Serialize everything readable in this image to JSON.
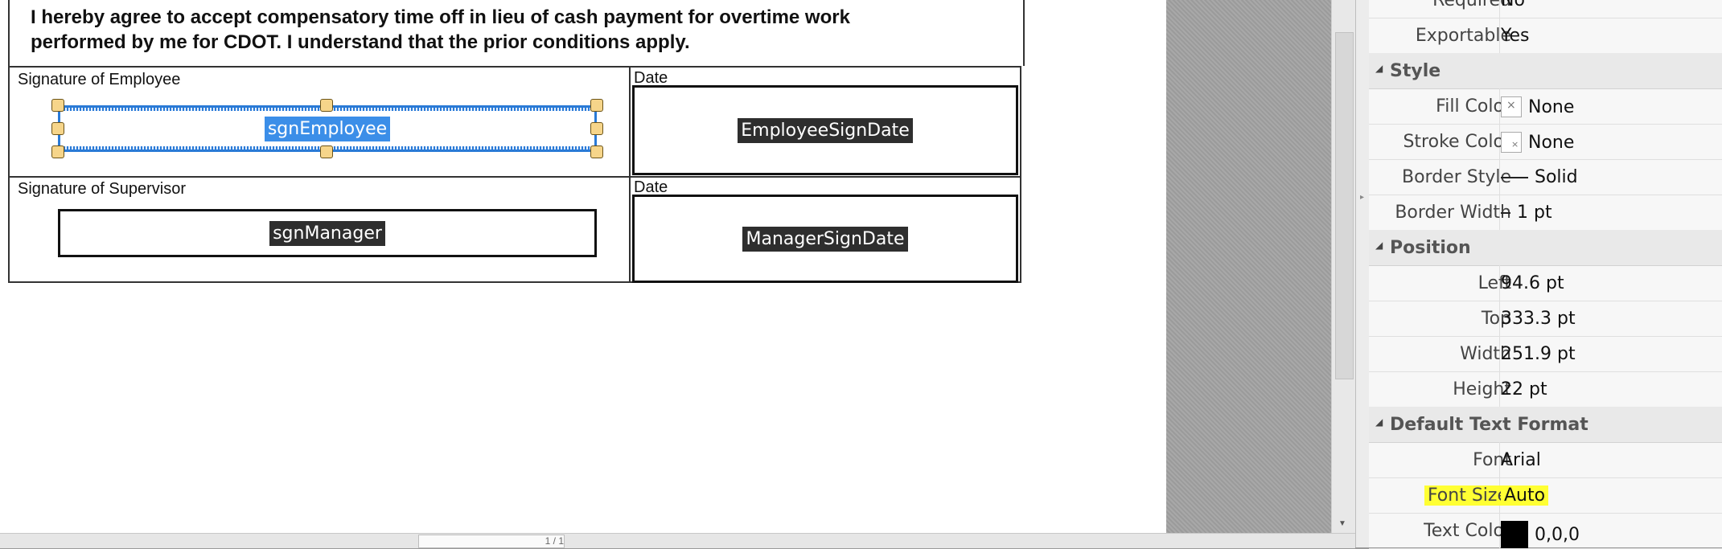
{
  "form": {
    "intro_line1": "I hereby agree to accept compensatory time off in lieu of cash payment for overtime work",
    "intro_line2": "performed by me for CDOT.  I understand that the prior conditions apply.",
    "sig_employee_label": "Signature of Employee",
    "date_label_1": "Date",
    "sig_supervisor_label": "Signature of Supervisor",
    "date_label_2": "Date",
    "fields": {
      "employee_sig": "sgnEmployee",
      "employee_date": "EmployeeSignDate",
      "manager_sig": "sgnManager",
      "manager_date": "ManagerSignDate"
    }
  },
  "properties": {
    "partial_top": {
      "name": "Required",
      "value": "No"
    },
    "exportable": {
      "name": "Exportable",
      "value": "Yes"
    },
    "style_section": "Style",
    "fill_color": {
      "name": "Fill Color",
      "value": "None"
    },
    "stroke_color": {
      "name": "Stroke Color",
      "value": "None"
    },
    "border_style": {
      "name": "Border Style",
      "value": "Solid"
    },
    "border_width": {
      "name": "Border Width",
      "value": "1 pt"
    },
    "position_section": "Position",
    "left": {
      "name": "Left",
      "value": "94.6 pt"
    },
    "top": {
      "name": "Top",
      "value": "333.3 pt"
    },
    "width": {
      "name": "Width",
      "value": "251.9 pt"
    },
    "height": {
      "name": "Height",
      "value": "22 pt"
    },
    "text_format_section": "Default Text Format",
    "font": {
      "name": "Font",
      "value": "Arial"
    },
    "font_size": {
      "name": "Font Size",
      "value": "Auto"
    },
    "text_color": {
      "name": "Text Color",
      "value": "0,0,0",
      "swatch": "#000000"
    }
  },
  "bottom": {
    "page_indicator": "1 / 1"
  },
  "icons": [
    "collapse-triangle-icon",
    "scroll-down-arrow-icon",
    "splitter-grip-icon"
  ],
  "colors": {
    "highlight": "#ffff33",
    "selection": "#3b8ee8",
    "handle": "#f6d58a"
  }
}
